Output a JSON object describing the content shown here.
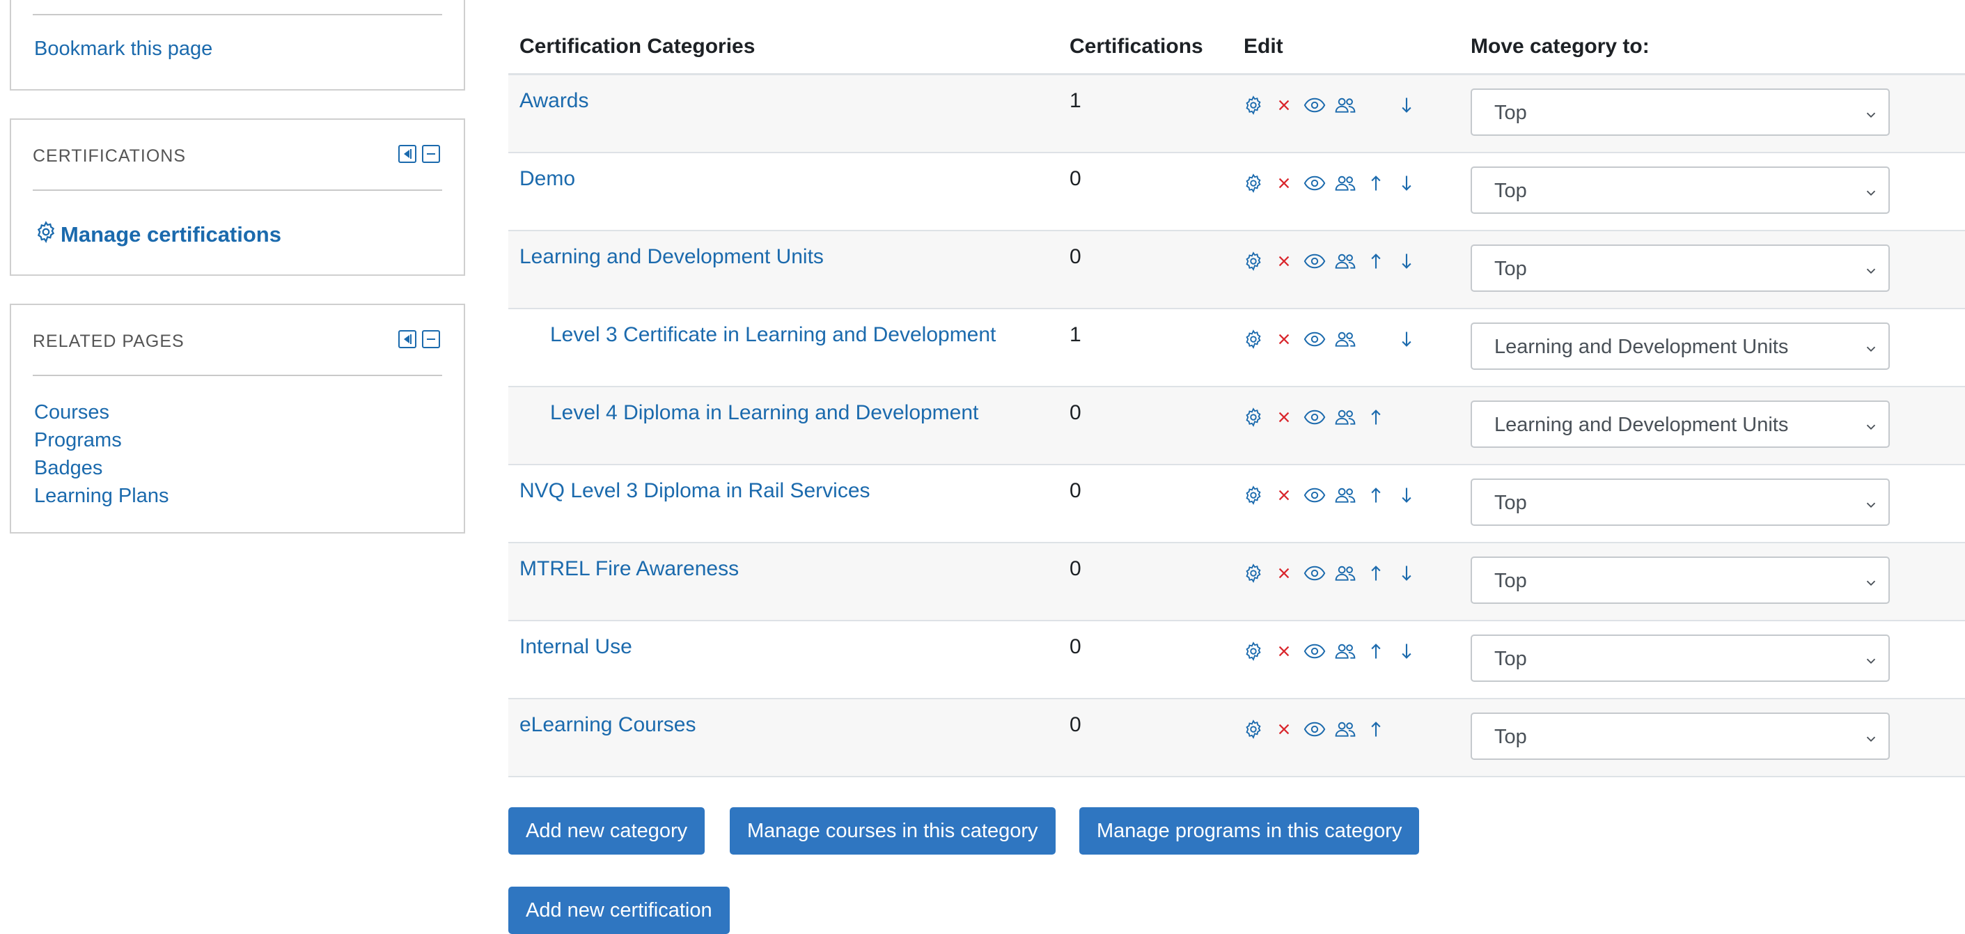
{
  "sidebar": {
    "nav_block": {
      "bookmark_label": "Bookmark this page"
    },
    "certifications_block": {
      "title": "CERTIFICATIONS",
      "manage_label": "Manage certifications"
    },
    "related_block": {
      "title": "RELATED PAGES",
      "links": [
        "Courses",
        "Programs",
        "Badges",
        "Learning Plans"
      ]
    }
  },
  "table": {
    "headers": {
      "categories": "Certification Categories",
      "certifications": "Certifications",
      "edit": "Edit",
      "move": "Move category to:"
    },
    "rows": [
      {
        "name": "Awards",
        "count": "1",
        "indent": false,
        "up": false,
        "down": true,
        "move_to": "Top"
      },
      {
        "name": "Demo",
        "count": "0",
        "indent": false,
        "up": true,
        "down": true,
        "move_to": "Top"
      },
      {
        "name": "Learning and Development Units",
        "count": "0",
        "indent": false,
        "up": true,
        "down": true,
        "move_to": "Top"
      },
      {
        "name": "Level 3 Certificate in Learning and Development",
        "count": "1",
        "indent": true,
        "up": false,
        "down": true,
        "move_to": "Learning and Development Units"
      },
      {
        "name": "Level 4 Diploma in Learning and Development",
        "count": "0",
        "indent": true,
        "up": true,
        "down": false,
        "move_to": "Learning and Development Units"
      },
      {
        "name": "NVQ Level 3 Diploma in Rail Services",
        "count": "0",
        "indent": false,
        "up": true,
        "down": true,
        "move_to": "Top"
      },
      {
        "name": "MTREL Fire Awareness",
        "count": "0",
        "indent": false,
        "up": true,
        "down": true,
        "move_to": "Top"
      },
      {
        "name": "Internal Use",
        "count": "0",
        "indent": false,
        "up": true,
        "down": true,
        "move_to": "Top"
      },
      {
        "name": "eLearning Courses",
        "count": "0",
        "indent": false,
        "up": true,
        "down": false,
        "move_to": "Top"
      }
    ]
  },
  "actions": {
    "add_category": "Add new category",
    "manage_courses": "Manage courses in this category",
    "manage_programs": "Manage programs in this category",
    "add_certification": "Add new certification"
  },
  "colors": {
    "link": "#1b6aad",
    "delete": "#d9262c",
    "button": "#2f76c1"
  }
}
